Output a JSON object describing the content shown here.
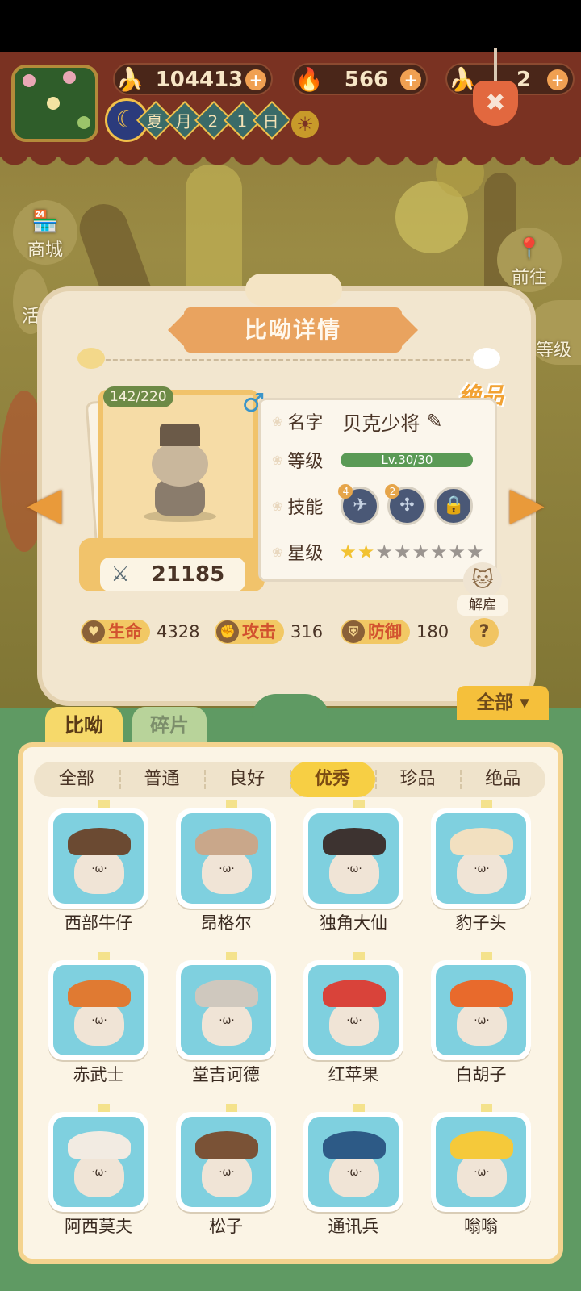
{
  "resources": {
    "banana": {
      "icon": "banana-icon",
      "value": "104413"
    },
    "flame": {
      "icon": "blue-flame-icon",
      "value": "566"
    },
    "ticket": {
      "icon": "blue-banana-icon",
      "value": "2"
    }
  },
  "season": {
    "days": [
      "夏",
      "月",
      "2",
      "1",
      "日"
    ]
  },
  "side_menu": {
    "shop": "商城",
    "activity": "活",
    "goto": "前往",
    "level": "等级"
  },
  "detail": {
    "title": "比呦详情",
    "hp_count": "142/220",
    "quality": "绝品",
    "power": "21185",
    "labels": {
      "name": "名字",
      "level": "等级",
      "skill": "技能",
      "star": "星级"
    },
    "name": "贝克少将",
    "level_text": "Lv.30/30",
    "level_fraction": 1.0,
    "skills": [
      {
        "num": "4",
        "icon": "wings-skill-icon"
      },
      {
        "num": "2",
        "icon": "compass-skill-icon"
      },
      {
        "num": "",
        "icon": "locked-skill-icon"
      }
    ],
    "stars": {
      "filled": 2,
      "total": 8
    },
    "fire_label": "解雇",
    "stats": [
      {
        "label": "生命",
        "value": "4328",
        "icon": "heart-icon"
      },
      {
        "label": "攻击",
        "value": "316",
        "icon": "paw-attack-icon"
      },
      {
        "label": "防御",
        "value": "180",
        "icon": "shield-icon"
      }
    ],
    "help": "?"
  },
  "collection": {
    "filter": "全部",
    "tabs": [
      "比呦",
      "碎片"
    ],
    "categories": [
      "全部",
      "普通",
      "良好",
      "优秀",
      "珍品",
      "绝品"
    ],
    "selected_category": "优秀",
    "items": [
      {
        "name": "西部牛仔",
        "hat": "#6b4a32"
      },
      {
        "name": "昂格尔",
        "hat": "#c9a78a"
      },
      {
        "name": "独角大仙",
        "hat": "#3d3330"
      },
      {
        "name": "豹子头",
        "hat": "#f2e0c0"
      },
      {
        "name": "赤武士",
        "hat": "#e07a32"
      },
      {
        "name": "堂吉诃德",
        "hat": "#cfc8be"
      },
      {
        "name": "红苹果",
        "hat": "#d9433a"
      },
      {
        "name": "白胡子",
        "hat": "#e86a2c"
      },
      {
        "name": "阿西莫夫",
        "hat": "#f2ebe2"
      },
      {
        "name": "松子",
        "hat": "#7a5236"
      },
      {
        "name": "通讯兵",
        "hat": "#2d5a86"
      },
      {
        "name": "嗡嗡",
        "hat": "#f5c93a"
      }
    ]
  }
}
